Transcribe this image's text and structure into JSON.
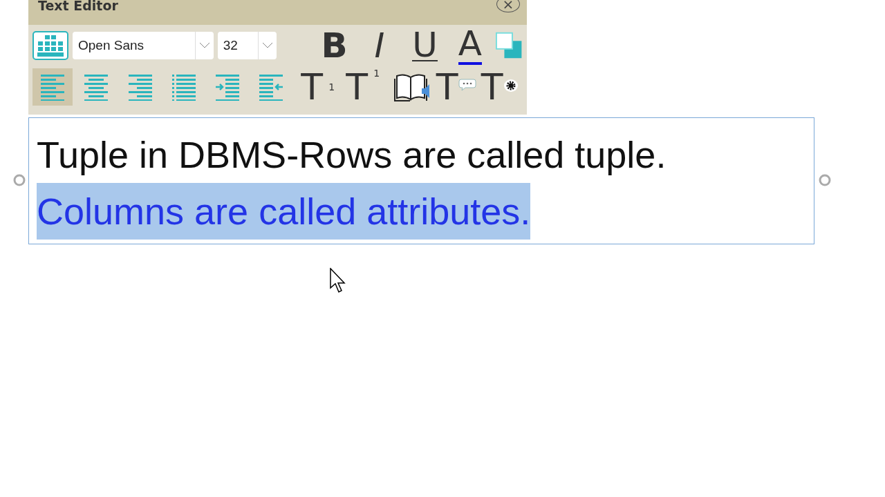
{
  "window": {
    "title": "Text Editor",
    "close": "×"
  },
  "toolbar": {
    "font": {
      "value": "Open Sans"
    },
    "size": {
      "value": "32"
    },
    "format_buttons": [
      {
        "kind": "bold",
        "label": "B"
      },
      {
        "kind": "italic",
        "label": "I"
      },
      {
        "kind": "underline",
        "label": "U"
      },
      {
        "kind": "color",
        "label": "A",
        "color": "#1010e0"
      }
    ],
    "align_buttons": [
      {
        "kind": "left",
        "selected": true
      },
      {
        "kind": "center",
        "selected": false
      },
      {
        "kind": "right",
        "selected": false
      },
      {
        "kind": "list",
        "selected": false
      },
      {
        "kind": "indent",
        "selected": false
      },
      {
        "kind": "outdent",
        "selected": false
      }
    ],
    "text_buttons": [
      {
        "kind": "subscript",
        "label": "T",
        "mark": "1"
      },
      {
        "kind": "superscript",
        "label": "T",
        "mark": "1"
      },
      {
        "kind": "book"
      },
      {
        "kind": "comment",
        "label": "T"
      },
      {
        "kind": "settings",
        "label": "T"
      }
    ]
  },
  "text_box": {
    "lines": [
      {
        "text": "Tuple in DBMS-Rows are called tuple.",
        "selected": false
      },
      {
        "text": "Columns are called attributes.",
        "selected": true
      }
    ]
  }
}
